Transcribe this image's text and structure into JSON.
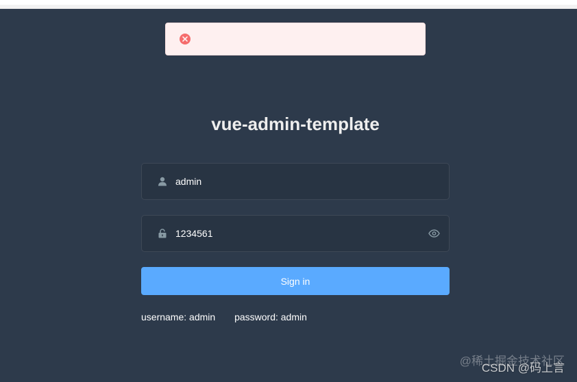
{
  "message": {
    "text": "",
    "type": "error",
    "icon": "close-circle-icon"
  },
  "login": {
    "title": "vue-admin-template",
    "username": {
      "value": "admin",
      "icon": "user-icon"
    },
    "password": {
      "value": "1234561",
      "icon": "lock-icon",
      "toggle_icon": "eye-icon"
    },
    "submit_label": "Sign in",
    "tips": {
      "username": "username: admin",
      "password": "password: admin"
    }
  },
  "watermark": {
    "back": "@稀土掘金技术社区",
    "front": "CSDN @码上言"
  },
  "colors": {
    "background": "#2d3a4b",
    "button": "#5aaaff",
    "error": "#f56c6c",
    "error_bg": "#fef0f0",
    "icon": "#889aa4"
  }
}
